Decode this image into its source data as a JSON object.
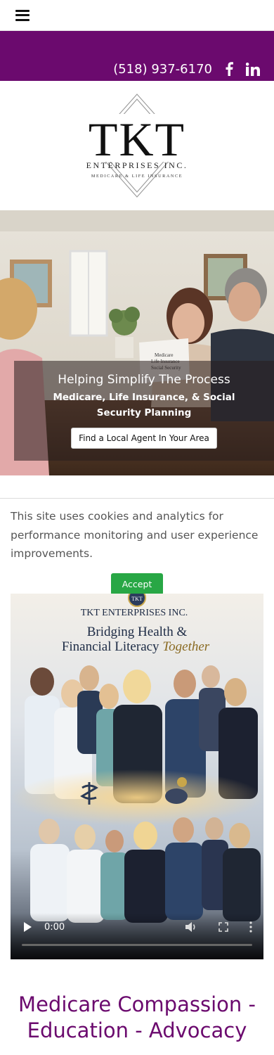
{
  "header": {
    "menu_icon": "hamburger-menu-icon"
  },
  "contact": {
    "phone": "(518) 937-6170",
    "facebook_icon": "facebook-icon",
    "linkedin_icon": "linkedin-icon",
    "bar_color": "#6b0a6e"
  },
  "logo": {
    "name": "TKT",
    "company": "ENTERPRISES INC.",
    "tagline": "MEDICARE & LIFE INSURANCE"
  },
  "hero": {
    "title": "Helping Simplify The Process",
    "subtitle": "Medicare, Life Insurance, & Social Security Planning",
    "button_label": "Find a Local Agent In Your Area",
    "document_text": "Medicare Life Insurance Social Security"
  },
  "cookie": {
    "message": "This site uses cookies and analytics for performance monitoring and user experience improvements.",
    "accept_label": "Accept",
    "accept_color": "#28a745"
  },
  "video": {
    "brand": "TKT ENTERPRISES INC.",
    "headline_line1": "Bridging Health &",
    "headline_line2_a": "Financial Literacy ",
    "headline_line2_b": "Together",
    "badge": "TKT",
    "time": "0:00",
    "play_icon": "play-icon",
    "volume_icon": "volume-icon",
    "fullscreen_icon": "fullscreen-icon",
    "more_icon": "more-options-icon"
  },
  "section": {
    "title": "Medicare Compassion - Education - Advocacy",
    "title_color": "#6b0a6e"
  }
}
